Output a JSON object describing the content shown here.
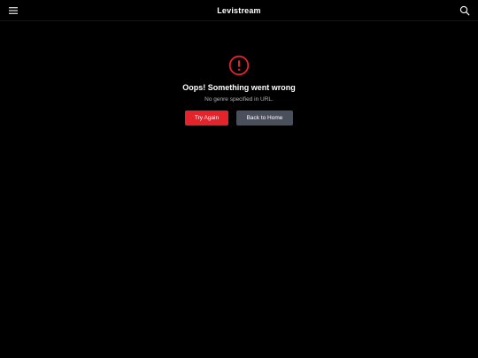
{
  "header": {
    "brand": "Levistream",
    "menu_icon": "hamburger-menu-icon",
    "search_icon": "search-icon"
  },
  "error": {
    "icon": "exclamation-circle-icon",
    "title": "Oops! Something went wrong",
    "message": "No genre specified in URL.",
    "retry_label": "Try Again",
    "home_label": "Back to Home"
  },
  "colors": {
    "background": "#000000",
    "accent": "#e5232a",
    "secondary_button": "#4a4f5c",
    "muted_text": "#b5b5b5"
  }
}
